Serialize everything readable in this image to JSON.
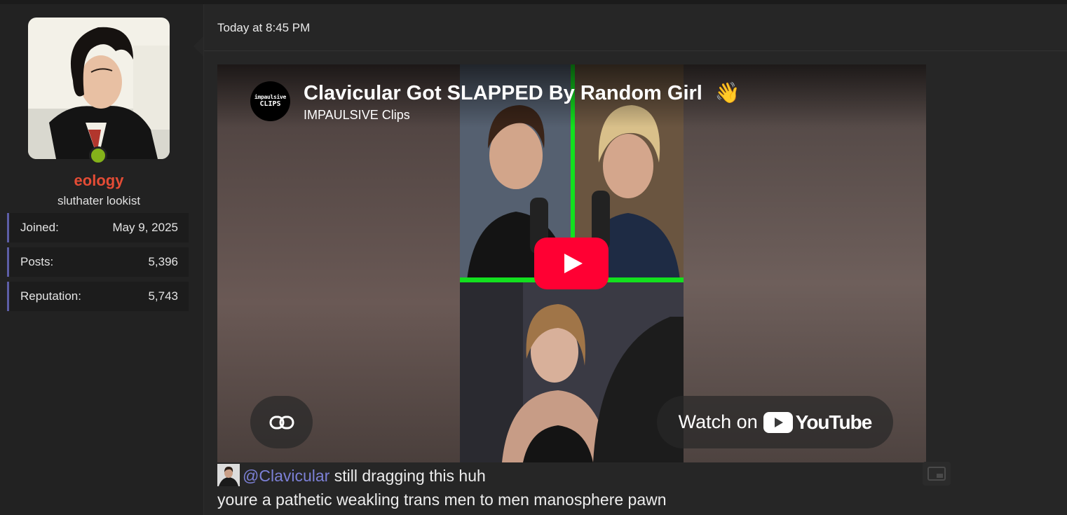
{
  "user": {
    "username": "eology",
    "user_title": "sluthater lookist",
    "online_status_color": "#84b21a",
    "username_color": "#e44c35",
    "stats": [
      {
        "label": "Joined:",
        "value": "May 9, 2025"
      },
      {
        "label": "Posts:",
        "value": "5,396"
      },
      {
        "label": "Reputation:",
        "value": "5,743"
      }
    ]
  },
  "post": {
    "timestamp": "Today at 8:45 PM",
    "embed": {
      "title": "Clavicular Got SLAPPED By Random Girl",
      "title_emoji": "👋",
      "channel": "IMPAULSIVE Clips",
      "channel_logo_line1": "impaulsive",
      "channel_logo_line2": "CLIPS",
      "watch_on_label": "Watch on",
      "youtube_wordmark": "YouTube",
      "play_button_color": "#ff0033",
      "icons": [
        "link-icon",
        "play-icon",
        "youtube-logo-icon"
      ]
    },
    "message": {
      "mention": "@Clavicular",
      "mention_color": "#7c80d6",
      "line1_rest": "still dragging this huh",
      "line2": "youre a pathetic weakling trans men to men manosphere pawn"
    }
  },
  "theme": {
    "background": "#232323",
    "post_background": "#262626",
    "stat_accent": "#5d5ea6"
  }
}
